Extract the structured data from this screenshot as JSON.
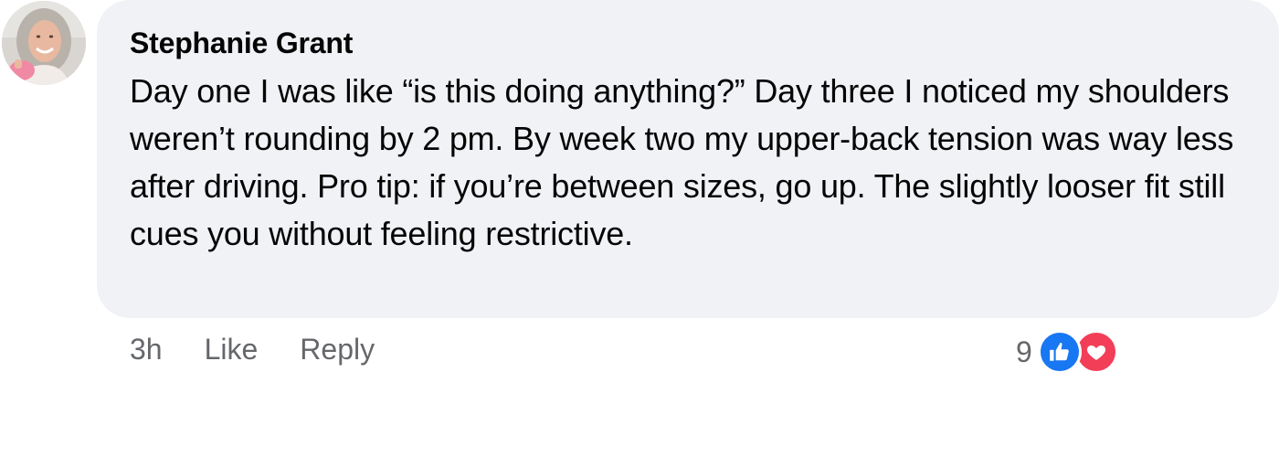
{
  "comment": {
    "author": "Stephanie Grant",
    "text": "Day one I was like “is this doing anything?” Day three I noticed my shoulders weren’t rounding by 2 pm. By week two my upper-back tension was way less after driving. Pro tip: if you’re between sizes, go up. The slightly looser fit still cues you without feeling restrictive.",
    "timestamp": "3h",
    "like_label": "Like",
    "reply_label": "Reply",
    "reaction_count": "9",
    "reactions": [
      "like-icon",
      "love-icon"
    ]
  },
  "colors": {
    "bubble_bg": "#f0f2f5",
    "text": "#050505",
    "meta_text": "#65676b",
    "like_blue": "#1877f2",
    "love_red": "#f33e58"
  }
}
